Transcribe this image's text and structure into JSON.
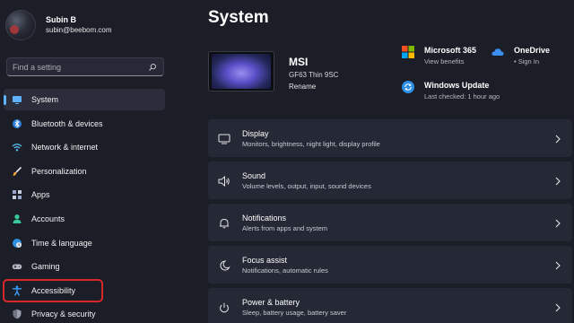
{
  "user": {
    "name": "Subin B",
    "email": "subin@beebom.com"
  },
  "search": {
    "placeholder": "Find a setting"
  },
  "nav": [
    {
      "label": "System",
      "icon": "system-icon",
      "color": "#5fb2ff",
      "active": true
    },
    {
      "label": "Bluetooth & devices",
      "icon": "bluetooth-icon",
      "color": "#4aa3ff"
    },
    {
      "label": "Network & internet",
      "icon": "wifi-icon",
      "color": "#5ac8fa"
    },
    {
      "label": "Personalization",
      "icon": "brush-icon",
      "color": "#f2a33a"
    },
    {
      "label": "Apps",
      "icon": "apps-icon",
      "color": "#9aa6c8"
    },
    {
      "label": "Accounts",
      "icon": "person-icon",
      "color": "#38c89a"
    },
    {
      "label": "Time & language",
      "icon": "globe-clock-icon",
      "color": "#4ab3ff"
    },
    {
      "label": "Gaming",
      "icon": "gamepad-icon",
      "color": "#b8bcc8"
    },
    {
      "label": "Accessibility",
      "icon": "accessibility-icon",
      "color": "#3aa0ff",
      "highlighted": true
    },
    {
      "label": "Privacy & security",
      "icon": "shield-icon",
      "color": "#9aa0ad"
    }
  ],
  "main": {
    "title": "System",
    "device": {
      "name": "MSI",
      "model": "GF63 Thin 9SC",
      "rename": "Rename"
    },
    "quick": [
      {
        "title": "Microsoft 365",
        "sub": "View benefits",
        "icon": "microsoft-logo-icon"
      },
      {
        "title": "OneDrive",
        "sub": "• Sign In",
        "icon": "onedrive-cloud-icon"
      },
      {
        "title": "Windows Update",
        "sub": "Last checked: 1 hour ago",
        "icon": "update-sync-icon"
      }
    ],
    "cards": [
      {
        "title": "Display",
        "desc": "Monitors, brightness, night light, display profile",
        "icon": "display-icon"
      },
      {
        "title": "Sound",
        "desc": "Volume levels, output, input, sound devices",
        "icon": "speaker-icon"
      },
      {
        "title": "Notifications",
        "desc": "Alerts from apps and system",
        "icon": "bell-icon"
      },
      {
        "title": "Focus assist",
        "desc": "Notifications, automatic rules",
        "icon": "moon-icon"
      },
      {
        "title": "Power & battery",
        "desc": "Sleep, battery usage, battery saver",
        "icon": "power-icon"
      }
    ]
  },
  "colors": {
    "accent": "#5fb2ff",
    "highlight_border": "#d62828",
    "background": "#1b1d27",
    "card": "#252835"
  }
}
